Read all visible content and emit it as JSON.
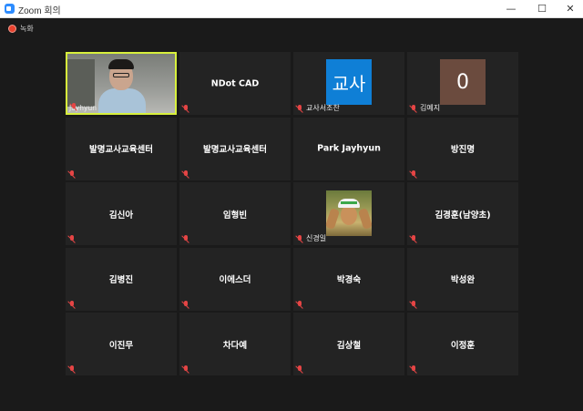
{
  "window": {
    "title": "Zoom 회의",
    "minimize_label": "—",
    "maximize_label": "☐",
    "close_label": "✕"
  },
  "recording": {
    "label": "녹화",
    "color": "#e8422e"
  },
  "participants": [
    {
      "name": "Jayhyun",
      "type": "video",
      "muted": true
    },
    {
      "name": "NDot CAD",
      "type": "name",
      "muted": true
    },
    {
      "name": "교사서조찬",
      "type": "avatar-text",
      "avatar_text": "교사",
      "avatar_color": "#0f7fd6",
      "muted": true
    },
    {
      "name": "김예지",
      "type": "avatar-letter",
      "avatar_text": "0",
      "avatar_color": "#6b4b3e",
      "muted": true
    },
    {
      "name": "발명교사교육센터",
      "type": "name",
      "muted": true
    },
    {
      "name": "발명교사교육센터",
      "type": "name",
      "muted": true
    },
    {
      "name": "Park Jayhyun",
      "type": "name",
      "muted": false
    },
    {
      "name": "방진명",
      "type": "name",
      "muted": true
    },
    {
      "name": "김신아",
      "type": "name",
      "muted": true
    },
    {
      "name": "임형빈",
      "type": "name",
      "muted": true
    },
    {
      "name": "신경일",
      "type": "photo",
      "muted": true
    },
    {
      "name": "김경훈(남양초)",
      "type": "name",
      "muted": true
    },
    {
      "name": "김병진",
      "type": "name",
      "muted": true
    },
    {
      "name": "이에스더",
      "type": "name",
      "muted": true
    },
    {
      "name": "박경숙",
      "type": "name",
      "muted": true
    },
    {
      "name": "박성완",
      "type": "name",
      "muted": true
    },
    {
      "name": "이진무",
      "type": "name",
      "muted": true
    },
    {
      "name": "차다예",
      "type": "name",
      "muted": true
    },
    {
      "name": "김상철",
      "type": "name",
      "muted": true
    },
    {
      "name": "이정훈",
      "type": "name",
      "muted": true
    }
  ],
  "colors": {
    "active_speaker_border": "#d8f03c",
    "tile_background": "#232323",
    "muted_icon": "#e54545"
  }
}
